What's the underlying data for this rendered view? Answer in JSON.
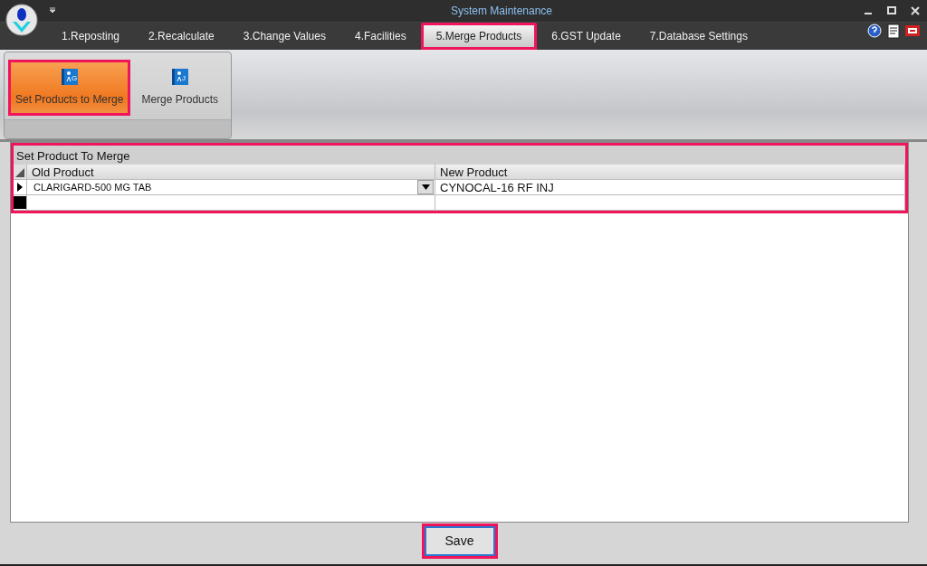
{
  "window": {
    "title": "System Maintenance"
  },
  "tabs": [
    {
      "label": "1.Reposting",
      "selected": false,
      "highlighted": false
    },
    {
      "label": "2.Recalculate",
      "selected": false,
      "highlighted": false
    },
    {
      "label": "3.Change Values",
      "selected": false,
      "highlighted": false
    },
    {
      "label": "4.Facilities",
      "selected": false,
      "highlighted": false
    },
    {
      "label": "5.Merge Products",
      "selected": true,
      "highlighted": true
    },
    {
      "label": "6.GST Update",
      "selected": false,
      "highlighted": false
    },
    {
      "label": "7.Database Settings",
      "selected": false,
      "highlighted": false
    }
  ],
  "ribbon": [
    {
      "label": "Set Products to Merge",
      "selected": true,
      "highlighted": true,
      "icon_letter": "G"
    },
    {
      "label": "Merge Products",
      "selected": false,
      "highlighted": false,
      "icon_letter": "J"
    }
  ],
  "grid": {
    "title": "Set Product To Merge",
    "highlighted": true,
    "columns": [
      "Old Product",
      "New Product"
    ],
    "rows": [
      {
        "cells": [
          "CLARIGARD-500 MG TAB",
          "CYNOCAL-16 RF INJ"
        ],
        "kind": "current"
      },
      {
        "cells": [
          "",
          ""
        ],
        "kind": "new"
      }
    ]
  },
  "save_button": {
    "label": "Save",
    "highlighted": true
  }
}
